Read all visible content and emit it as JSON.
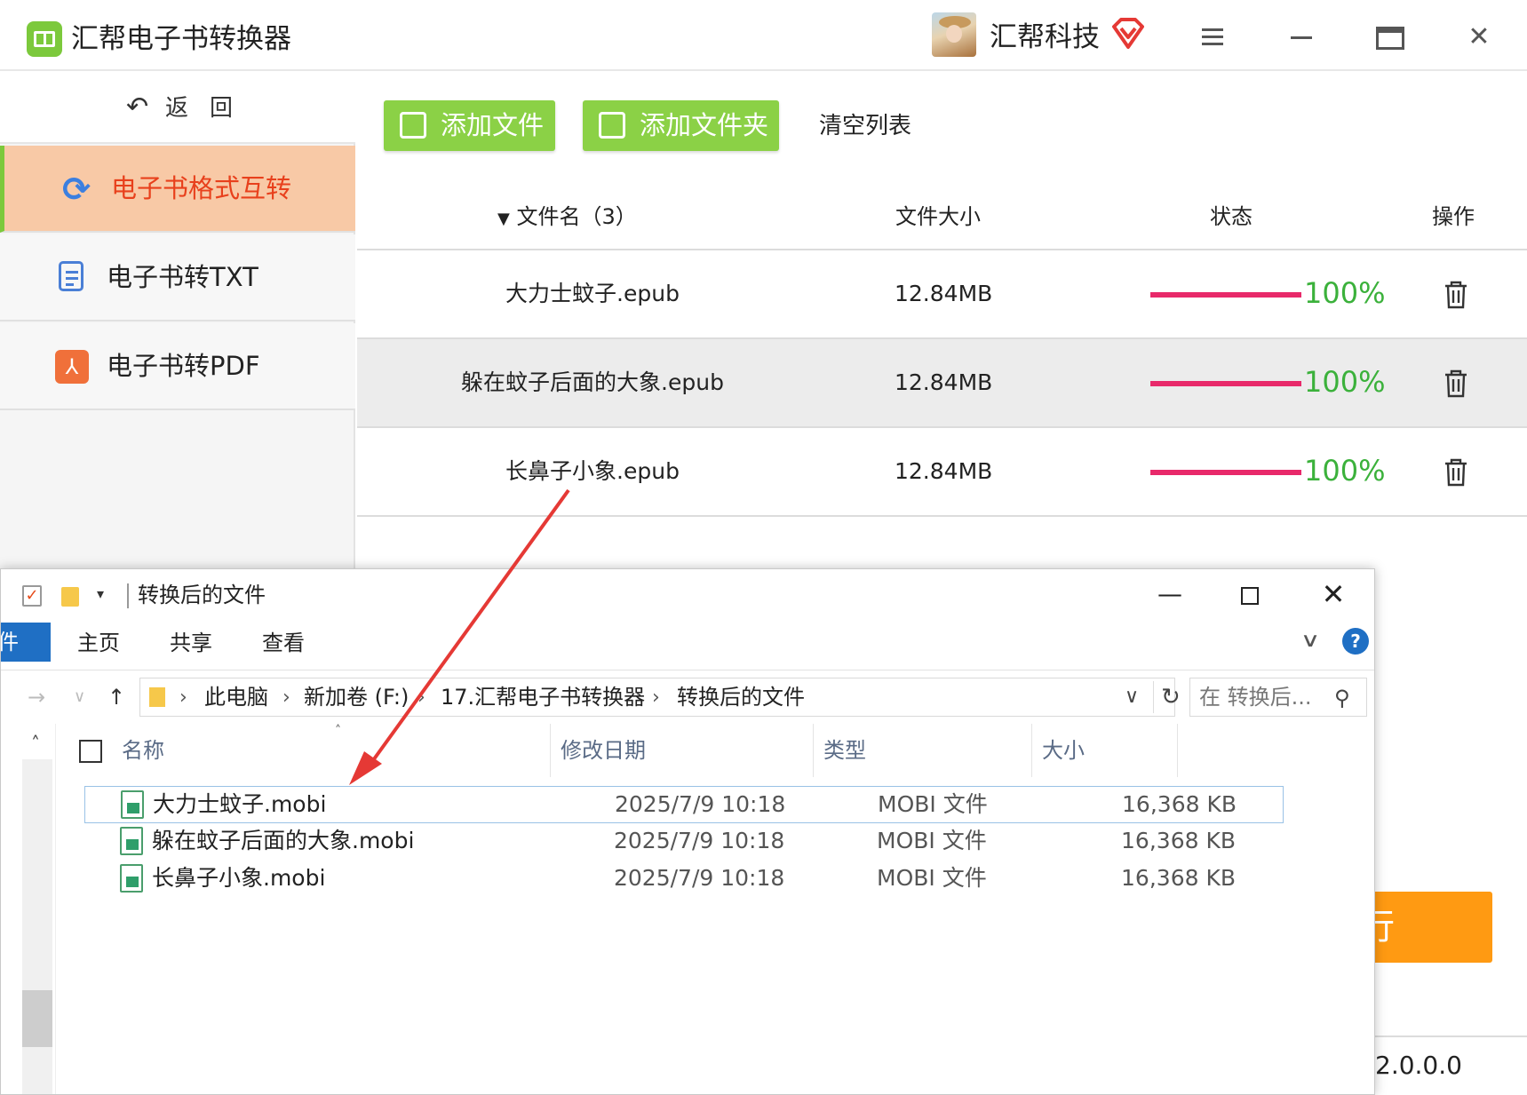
{
  "app": {
    "title": "汇帮电子书转换器",
    "brand_name": "汇帮科技"
  },
  "sidebar": {
    "back_label": "返回",
    "items": [
      {
        "label": "电子书格式互转",
        "icon": "refresh-icon",
        "active": true
      },
      {
        "label": "电子书转TXT",
        "icon": "txt-file-icon",
        "active": false
      },
      {
        "label": "电子书转PDF",
        "icon": "pdf-icon",
        "active": false
      }
    ]
  },
  "toolbar": {
    "add_file": "添加文件",
    "add_folder": "添加文件夹",
    "clear_list": "清空列表"
  },
  "table": {
    "headers": {
      "name": "文件名（3）",
      "size": "文件大小",
      "status": "状态",
      "action": "操作"
    },
    "rows": [
      {
        "name": "大力士蚊子.epub",
        "size": "12.84MB",
        "progress": 100,
        "status": "100%"
      },
      {
        "name": "躲在蚊子后面的大象.epub",
        "size": "12.84MB",
        "progress": 100,
        "status": "100%"
      },
      {
        "name": "长鼻子小象.epub",
        "size": "12.84MB",
        "progress": 100,
        "status": "100%"
      }
    ]
  },
  "run_button_partial": "行",
  "version_partial": "：2.0.0.0",
  "explorer": {
    "title": "转换后的文件",
    "ribbon": {
      "file": "件",
      "tabs": [
        "主页",
        "共享",
        "查看"
      ]
    },
    "breadcrumb": [
      "此电脑",
      "新加卷 (F:)",
      "17.汇帮电子书转换器",
      "转换后的文件"
    ],
    "search_placeholder": "在 转换后...",
    "columns": {
      "name": "名称",
      "modified": "修改日期",
      "type": "类型",
      "size": "大小"
    },
    "files": [
      {
        "name": "大力士蚊子.mobi",
        "modified": "2025/7/9 10:18",
        "type": "MOBI 文件",
        "size": "16,368 KB"
      },
      {
        "name": "躲在蚊子后面的大象.mobi",
        "modified": "2025/7/9 10:18",
        "type": "MOBI 文件",
        "size": "16,368 KB"
      },
      {
        "name": "长鼻子小象.mobi",
        "modified": "2025/7/9 10:18",
        "type": "MOBI 文件",
        "size": "16,368 KB"
      }
    ]
  },
  "colors": {
    "accent_green": "#8bd146",
    "active_item_bg": "#f8c9a6",
    "active_item_text": "#e8401c",
    "progress_bar": "#e8296a",
    "percent_text": "#3bb13b",
    "run_button": "#ff9a12",
    "annotation_arrow": "#e53935"
  }
}
